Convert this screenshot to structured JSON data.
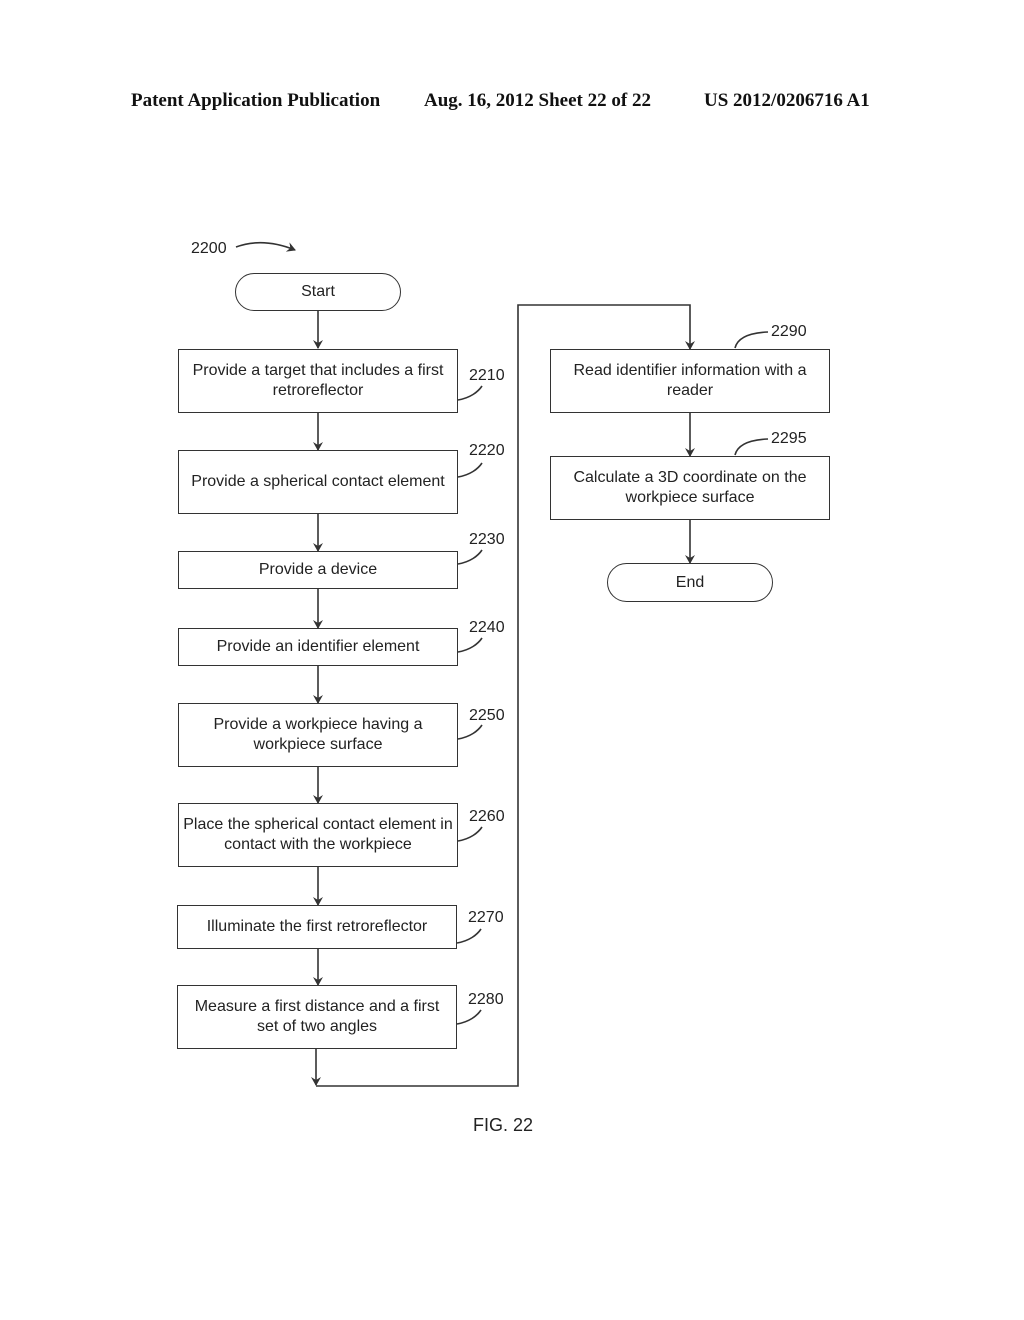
{
  "header": {
    "publication": "Patent Application Publication",
    "date_sheet": "Aug. 16, 2012  Sheet 22 of 22",
    "number": "US 2012/0206716 A1"
  },
  "diagram": {
    "ref": "2200",
    "start": "Start",
    "end": "End",
    "steps": [
      {
        "id": "2210",
        "text": "Provide a target that includes a first retroreflector"
      },
      {
        "id": "2220",
        "text": "Provide a spherical contact element"
      },
      {
        "id": "2230",
        "text": "Provide a device"
      },
      {
        "id": "2240",
        "text": "Provide an identifier element"
      },
      {
        "id": "2250",
        "text": "Provide a workpiece having a workpiece surface"
      },
      {
        "id": "2260",
        "text": "Place the spherical contact element in contact with the workpiece"
      },
      {
        "id": "2270",
        "text": "Illuminate the first retroreflector"
      },
      {
        "id": "2280",
        "text": "Measure a first distance and a first set of two angles"
      },
      {
        "id": "2290",
        "text": "Read identifier information with a reader"
      },
      {
        "id": "2295",
        "text": "Calculate a 3D coordinate on the workpiece surface"
      }
    ],
    "caption": "FIG. 22"
  }
}
